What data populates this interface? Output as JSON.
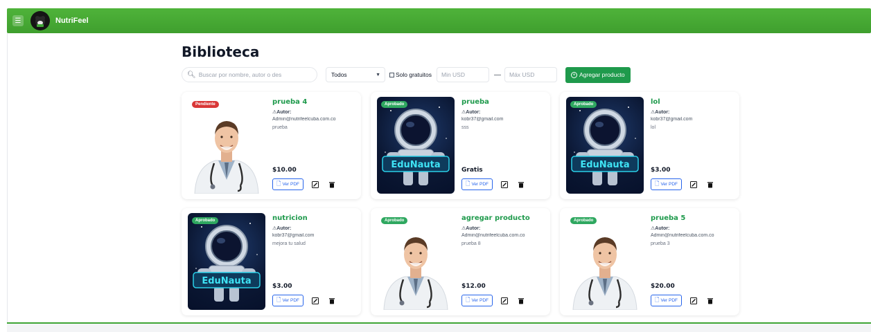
{
  "app": {
    "brand": "NutriFeel"
  },
  "page": {
    "title": "Biblioteca"
  },
  "filters": {
    "search_placeholder": "Buscar por nombre, autor o des",
    "category_selected": "Todos",
    "free_only_label": "Solo gratuitos",
    "min_placeholder": "Min USD",
    "dash": "—",
    "max_placeholder": "Máx USD",
    "add_button": "Agregar producto"
  },
  "labels": {
    "author": "Autor:",
    "view_pdf": "Ver PDF"
  },
  "products": [
    {
      "name": "prueba 4",
      "status": "Pendiente",
      "email": "Admin@nutrifeelcuba.com.co",
      "description": "prueba",
      "price": "$10.00",
      "image": "doctor"
    },
    {
      "name": "prueba",
      "status": "Aprobado",
      "email": "kobr37@gmail.com",
      "description": "sss",
      "price": "Gratis",
      "image": "edunauta"
    },
    {
      "name": "lol",
      "status": "Aprobado",
      "email": "kobr37@gmail.com",
      "description": "lol",
      "price": "$3.00",
      "image": "edunauta"
    },
    {
      "name": "nutricion",
      "status": "Aprobado",
      "email": "kobr37@gmail.com",
      "description": "mejora tu salud",
      "price": "$3.00",
      "image": "edunauta"
    },
    {
      "name": "agregar producto",
      "status": "Aprobado",
      "email": "Admin@nutrifeelcuba.com.co",
      "description": "prueba 8",
      "price": "$12.00",
      "image": "doctor"
    },
    {
      "name": "prueba 5",
      "status": "Aprobado",
      "email": "Admin@nutrifeelcuba.com.co",
      "description": "prueba 3",
      "price": "$20.00",
      "image": "doctor"
    }
  ],
  "colors": {
    "brand_green": "#3fa535",
    "accent_green": "#1f9a4c",
    "pending_red": "#d93737",
    "link_blue": "#2563eb"
  }
}
